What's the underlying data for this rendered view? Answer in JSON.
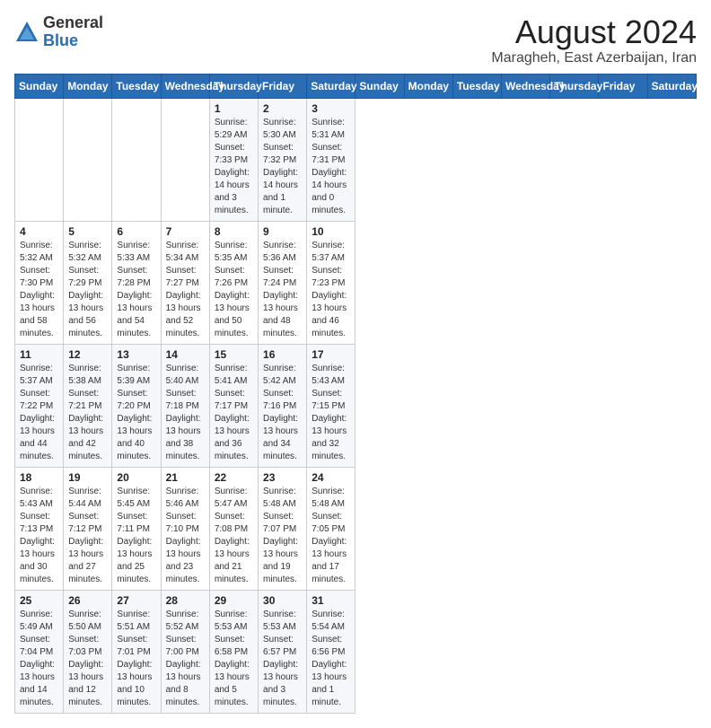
{
  "header": {
    "logo_general": "General",
    "logo_blue": "Blue",
    "month_year": "August 2024",
    "location": "Maragheh, East Azerbaijan, Iran"
  },
  "days_of_week": [
    "Sunday",
    "Monday",
    "Tuesday",
    "Wednesday",
    "Thursday",
    "Friday",
    "Saturday"
  ],
  "weeks": [
    [
      {
        "day": "",
        "info": ""
      },
      {
        "day": "",
        "info": ""
      },
      {
        "day": "",
        "info": ""
      },
      {
        "day": "",
        "info": ""
      },
      {
        "day": "1",
        "info": "Sunrise: 5:29 AM\nSunset: 7:33 PM\nDaylight: 14 hours\nand 3 minutes."
      },
      {
        "day": "2",
        "info": "Sunrise: 5:30 AM\nSunset: 7:32 PM\nDaylight: 14 hours\nand 1 minute."
      },
      {
        "day": "3",
        "info": "Sunrise: 5:31 AM\nSunset: 7:31 PM\nDaylight: 14 hours\nand 0 minutes."
      }
    ],
    [
      {
        "day": "4",
        "info": "Sunrise: 5:32 AM\nSunset: 7:30 PM\nDaylight: 13 hours\nand 58 minutes."
      },
      {
        "day": "5",
        "info": "Sunrise: 5:32 AM\nSunset: 7:29 PM\nDaylight: 13 hours\nand 56 minutes."
      },
      {
        "day": "6",
        "info": "Sunrise: 5:33 AM\nSunset: 7:28 PM\nDaylight: 13 hours\nand 54 minutes."
      },
      {
        "day": "7",
        "info": "Sunrise: 5:34 AM\nSunset: 7:27 PM\nDaylight: 13 hours\nand 52 minutes."
      },
      {
        "day": "8",
        "info": "Sunrise: 5:35 AM\nSunset: 7:26 PM\nDaylight: 13 hours\nand 50 minutes."
      },
      {
        "day": "9",
        "info": "Sunrise: 5:36 AM\nSunset: 7:24 PM\nDaylight: 13 hours\nand 48 minutes."
      },
      {
        "day": "10",
        "info": "Sunrise: 5:37 AM\nSunset: 7:23 PM\nDaylight: 13 hours\nand 46 minutes."
      }
    ],
    [
      {
        "day": "11",
        "info": "Sunrise: 5:37 AM\nSunset: 7:22 PM\nDaylight: 13 hours\nand 44 minutes."
      },
      {
        "day": "12",
        "info": "Sunrise: 5:38 AM\nSunset: 7:21 PM\nDaylight: 13 hours\nand 42 minutes."
      },
      {
        "day": "13",
        "info": "Sunrise: 5:39 AM\nSunset: 7:20 PM\nDaylight: 13 hours\nand 40 minutes."
      },
      {
        "day": "14",
        "info": "Sunrise: 5:40 AM\nSunset: 7:18 PM\nDaylight: 13 hours\nand 38 minutes."
      },
      {
        "day": "15",
        "info": "Sunrise: 5:41 AM\nSunset: 7:17 PM\nDaylight: 13 hours\nand 36 minutes."
      },
      {
        "day": "16",
        "info": "Sunrise: 5:42 AM\nSunset: 7:16 PM\nDaylight: 13 hours\nand 34 minutes."
      },
      {
        "day": "17",
        "info": "Sunrise: 5:43 AM\nSunset: 7:15 PM\nDaylight: 13 hours\nand 32 minutes."
      }
    ],
    [
      {
        "day": "18",
        "info": "Sunrise: 5:43 AM\nSunset: 7:13 PM\nDaylight: 13 hours\nand 30 minutes."
      },
      {
        "day": "19",
        "info": "Sunrise: 5:44 AM\nSunset: 7:12 PM\nDaylight: 13 hours\nand 27 minutes."
      },
      {
        "day": "20",
        "info": "Sunrise: 5:45 AM\nSunset: 7:11 PM\nDaylight: 13 hours\nand 25 minutes."
      },
      {
        "day": "21",
        "info": "Sunrise: 5:46 AM\nSunset: 7:10 PM\nDaylight: 13 hours\nand 23 minutes."
      },
      {
        "day": "22",
        "info": "Sunrise: 5:47 AM\nSunset: 7:08 PM\nDaylight: 13 hours\nand 21 minutes."
      },
      {
        "day": "23",
        "info": "Sunrise: 5:48 AM\nSunset: 7:07 PM\nDaylight: 13 hours\nand 19 minutes."
      },
      {
        "day": "24",
        "info": "Sunrise: 5:48 AM\nSunset: 7:05 PM\nDaylight: 13 hours\nand 17 minutes."
      }
    ],
    [
      {
        "day": "25",
        "info": "Sunrise: 5:49 AM\nSunset: 7:04 PM\nDaylight: 13 hours\nand 14 minutes."
      },
      {
        "day": "26",
        "info": "Sunrise: 5:50 AM\nSunset: 7:03 PM\nDaylight: 13 hours\nand 12 minutes."
      },
      {
        "day": "27",
        "info": "Sunrise: 5:51 AM\nSunset: 7:01 PM\nDaylight: 13 hours\nand 10 minutes."
      },
      {
        "day": "28",
        "info": "Sunrise: 5:52 AM\nSunset: 7:00 PM\nDaylight: 13 hours\nand 8 minutes."
      },
      {
        "day": "29",
        "info": "Sunrise: 5:53 AM\nSunset: 6:58 PM\nDaylight: 13 hours\nand 5 minutes."
      },
      {
        "day": "30",
        "info": "Sunrise: 5:53 AM\nSunset: 6:57 PM\nDaylight: 13 hours\nand 3 minutes."
      },
      {
        "day": "31",
        "info": "Sunrise: 5:54 AM\nSunset: 6:56 PM\nDaylight: 13 hours\nand 1 minute."
      }
    ]
  ]
}
